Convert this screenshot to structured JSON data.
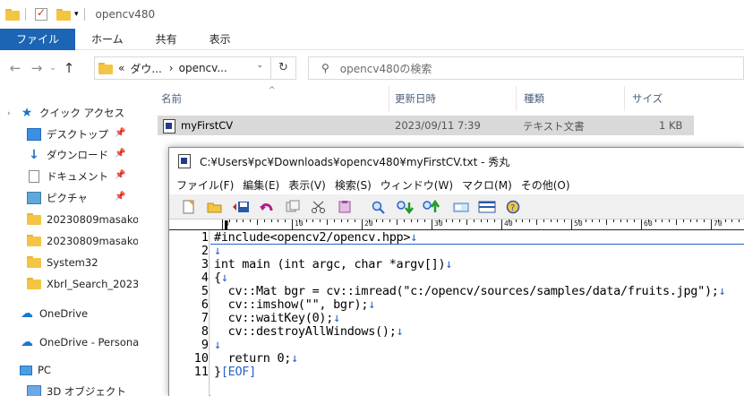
{
  "explorer": {
    "title": "opencv480",
    "ribbon_tabs": [
      "ファイル",
      "ホーム",
      "共有",
      "表示"
    ],
    "address": {
      "prefix": "«",
      "crumb1": "ダウ...",
      "crumb2": "opencv..."
    },
    "search_placeholder": "opencv480の検索",
    "nav": {
      "quick_access": "クイック アクセス",
      "items": [
        "デスクトップ",
        "ダウンロード",
        "ドキュメント",
        "ピクチャ",
        "20230809masako",
        "20230809masako",
        "System32",
        "Xbrl_Search_2023"
      ],
      "onedrive": "OneDrive",
      "onedrive_personal": "OneDrive - Persona",
      "pc": "PC",
      "objects3d": "3D オブジェクト"
    },
    "columns": {
      "name": "名前",
      "date": "更新日時",
      "type": "種類",
      "size": "サイズ"
    },
    "file": {
      "name": "myFirstCV",
      "date": "2023/09/11 7:39",
      "type": "テキスト文書",
      "size": "1 KB"
    }
  },
  "editor": {
    "title": "C:¥Users¥pc¥Downloads¥opencv480¥myFirstCV.txt - 秀丸",
    "menu": [
      "ファイル(F)",
      "編集(E)",
      "表示(V)",
      "検索(S)",
      "ウィンドウ(W)",
      "マクロ(M)",
      "その他(O)"
    ],
    "ruler_numbers": [
      "0",
      "10",
      "20",
      "30",
      "40",
      "50",
      "60",
      "70"
    ],
    "lines": [
      {
        "num": "1",
        "text": "#include<opencv2/opencv.hpp>",
        "nl": "↓"
      },
      {
        "num": "2",
        "text": "",
        "nl": "↓"
      },
      {
        "num": "3",
        "text": "int main (int argc, char *argv[])",
        "nl": "↓"
      },
      {
        "num": "4",
        "text": "{",
        "nl": "↓"
      },
      {
        "num": "5",
        "text": "  cv::Mat bgr = cv::imread(\"c:/opencv/sources/samples/data/fruits.jpg\");",
        "nl": "↓"
      },
      {
        "num": "6",
        "text": "  cv::imshow(\"\", bgr);",
        "nl": "↓"
      },
      {
        "num": "7",
        "text": "  cv::waitKey(0);",
        "nl": "↓"
      },
      {
        "num": "8",
        "text": "  cv::destroyAllWindows();",
        "nl": "↓"
      },
      {
        "num": "9",
        "text": "",
        "nl": "↓"
      },
      {
        "num": "10",
        "text": "  return 0;",
        "nl": "↓"
      },
      {
        "num": "11",
        "text": "}",
        "nl": "[EOF]"
      }
    ]
  },
  "colors": {
    "ribbon_active": "#1c64b4",
    "newline_marker": "#2a61c7",
    "selection": "#d9d9d9"
  }
}
